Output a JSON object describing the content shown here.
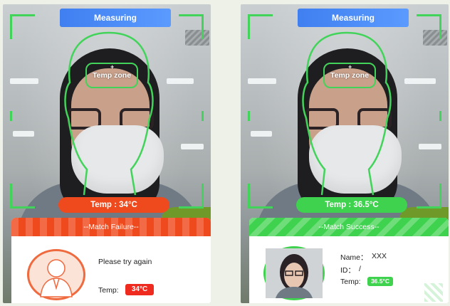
{
  "colors": {
    "accent_green": "#42d45a",
    "alert_red": "#ef4a1e",
    "banner_blue": "#4a8cf5"
  },
  "left_panel": {
    "banner": "Measuring",
    "temp_zone_label": "Temp zone",
    "temp_reading": "Temp : 34°C",
    "card": {
      "header": "--Match Failure--",
      "message": "Please try again",
      "temp_label": "Temp:",
      "temp_value": "34°C",
      "avatar_icon": "person-silhouette-icon"
    }
  },
  "right_panel": {
    "banner": "Measuring",
    "temp_zone_label": "Temp zone",
    "temp_reading": "Temp : 36.5°C",
    "card": {
      "header": "--Match Success--",
      "name_label": "Name：",
      "name_value": "XXX",
      "id_label": "ID：",
      "id_value": "/",
      "temp_label": "Temp:",
      "temp_value": "36.5°C"
    }
  }
}
